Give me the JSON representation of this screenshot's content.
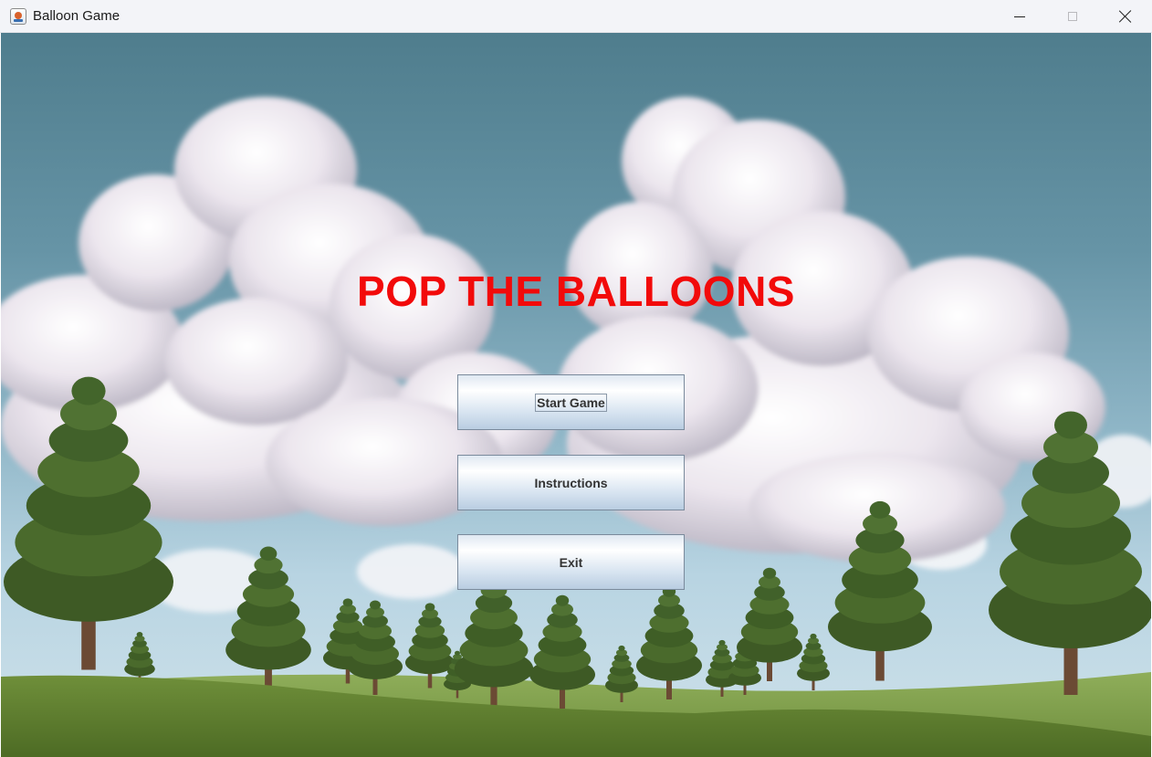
{
  "window": {
    "title": "Balloon Game",
    "icon": "java-cup-icon"
  },
  "game": {
    "title": "POP THE BALLOONS",
    "title_color": "#f20a0a"
  },
  "menu": {
    "start_label": "Start Game",
    "instructions_label": "Instructions",
    "exit_label": "Exit"
  }
}
